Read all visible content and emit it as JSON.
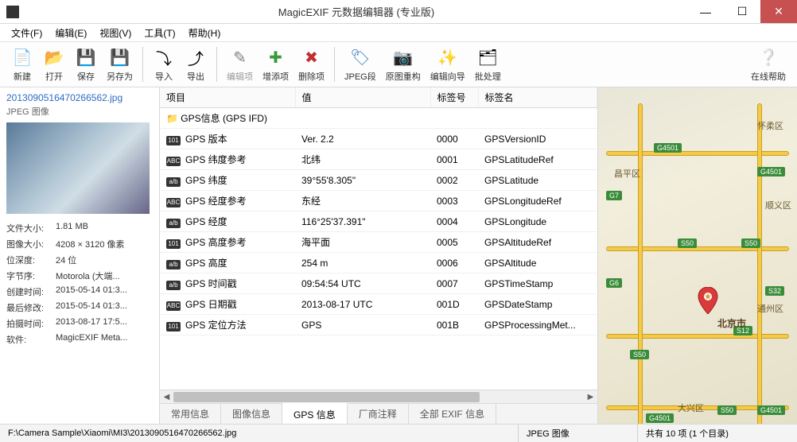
{
  "window": {
    "title": "MagicEXIF 元数据编辑器 (专业版)"
  },
  "menu": [
    "文件(F)",
    "编辑(E)",
    "视图(V)",
    "工具(T)",
    "帮助(H)"
  ],
  "toolbar": {
    "new": "新建",
    "open": "打开",
    "save": "保存",
    "saveas": "另存为",
    "import": "导入",
    "export": "导出",
    "edit": "编辑项",
    "add": "增添项",
    "delete": "删除项",
    "jpeg": "JPEG段",
    "rebuild": "原图重构",
    "wizard": "编辑向导",
    "batch": "批处理",
    "help": "在线帮助"
  },
  "file": {
    "name": "20130905164702665​62.jpg",
    "type": "JPEG 图像"
  },
  "meta": [
    {
      "k": "文件大小:",
      "v": "1.81 MB"
    },
    {
      "k": "图像大小:",
      "v": "4208 × 3120 像素"
    },
    {
      "k": "位深度:",
      "v": "24 位"
    },
    {
      "k": "字节序:",
      "v": "Motorola (大端..."
    },
    {
      "k": "创建时间:",
      "v": "2015-05-14 01:3..."
    },
    {
      "k": "最后修改:",
      "v": "2015-05-14 01:3..."
    },
    {
      "k": "拍摄时间:",
      "v": "2013-08-17 17:5..."
    },
    {
      "k": "软件:",
      "v": "MagicEXIF Meta..."
    }
  ],
  "grid": {
    "cols": [
      "项目",
      "值",
      "标签号",
      "标签名"
    ],
    "group": "GPS信息 (GPS IFD)",
    "rows": [
      {
        "item": "GPS 版本",
        "val": "Ver. 2.2",
        "tag": "0000",
        "name": "GPSVersionID"
      },
      {
        "item": "GPS 纬度参考",
        "val": "北纬",
        "tag": "0001",
        "name": "GPSLatitudeRef"
      },
      {
        "item": "GPS 纬度",
        "val": "39°55'8.305\"",
        "tag": "0002",
        "name": "GPSLatitude"
      },
      {
        "item": "GPS 经度参考",
        "val": "东经",
        "tag": "0003",
        "name": "GPSLongitudeRef"
      },
      {
        "item": "GPS 经度",
        "val": "116°25'37.391\"",
        "tag": "0004",
        "name": "GPSLongitude"
      },
      {
        "item": "GPS 高度参考",
        "val": "海平面",
        "tag": "0005",
        "name": "GPSAltitudeRef"
      },
      {
        "item": "GPS 高度",
        "val": "254 m",
        "tag": "0006",
        "name": "GPSAltitude"
      },
      {
        "item": "GPS 时间戳",
        "val": "09:54:54 UTC",
        "tag": "0007",
        "name": "GPSTimeStamp"
      },
      {
        "item": "GPS 日期戳",
        "val": "2013-08-17 UTC",
        "tag": "001D",
        "name": "GPSDateStamp"
      },
      {
        "item": "GPS 定位方法",
        "val": "GPS",
        "tag": "001B",
        "name": "GPSProcessingMet..."
      }
    ]
  },
  "tabs": [
    "常用信息",
    "图像信息",
    "GPS 信息",
    "厂商注释",
    "全部 EXIF 信息"
  ],
  "activeTab": 2,
  "map": {
    "city": "北京市"
  },
  "status": {
    "path": "F:\\Camera Sample\\Xiaomi\\MI3\\2013090516470266562.jpg",
    "type": "JPEG 图像",
    "count": "共有 10 项 (1 个目录)"
  }
}
